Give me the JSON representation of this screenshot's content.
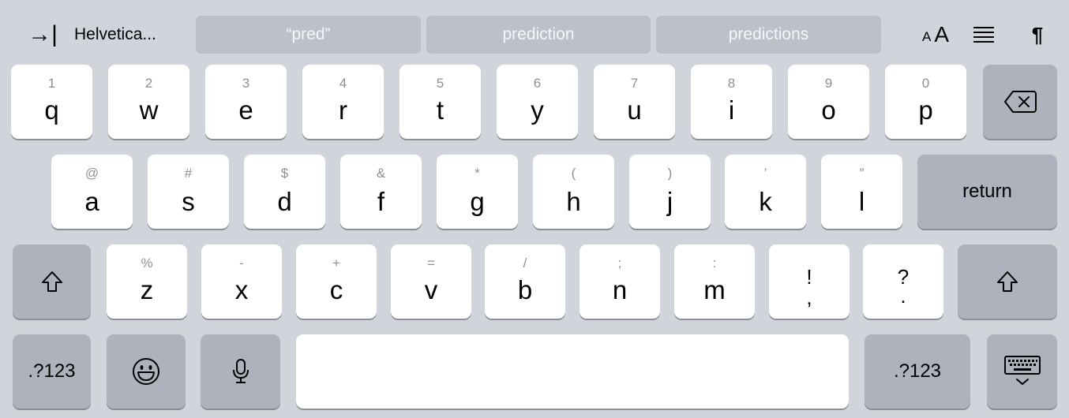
{
  "toolbar": {
    "tab_icon": "→|",
    "font_name": "Helvetica...",
    "suggestions": [
      "“pred”",
      "prediction",
      "predictions"
    ],
    "fontsize_small": "A",
    "fontsize_big": "A",
    "pilcrow": "¶"
  },
  "rows": {
    "row1": [
      {
        "hint": "1",
        "char": "q"
      },
      {
        "hint": "2",
        "char": "w"
      },
      {
        "hint": "3",
        "char": "e"
      },
      {
        "hint": "4",
        "char": "r"
      },
      {
        "hint": "5",
        "char": "t"
      },
      {
        "hint": "6",
        "char": "y"
      },
      {
        "hint": "7",
        "char": "u"
      },
      {
        "hint": "8",
        "char": "i"
      },
      {
        "hint": "9",
        "char": "o"
      },
      {
        "hint": "0",
        "char": "p"
      }
    ],
    "row2": [
      {
        "hint": "@",
        "char": "a"
      },
      {
        "hint": "#",
        "char": "s"
      },
      {
        "hint": "$",
        "char": "d"
      },
      {
        "hint": "&",
        "char": "f"
      },
      {
        "hint": "*",
        "char": "g"
      },
      {
        "hint": "(",
        "char": "h"
      },
      {
        "hint": ")",
        "char": "j"
      },
      {
        "hint": "’",
        "char": "k"
      },
      {
        "hint": "”",
        "char": "l"
      }
    ],
    "row3": [
      {
        "hint": "%",
        "char": "z"
      },
      {
        "hint": "-",
        "char": "x"
      },
      {
        "hint": "+",
        "char": "c"
      },
      {
        "hint": "=",
        "char": "v"
      },
      {
        "hint": "/",
        "char": "b"
      },
      {
        "hint": ";",
        "char": "n"
      },
      {
        "hint": ":",
        "char": "m"
      }
    ],
    "punct": [
      {
        "top": "!",
        "bottom": ","
      },
      {
        "top": "?",
        "bottom": "."
      }
    ]
  },
  "special": {
    "return_label": "return",
    "numbers_label_left": ".?123",
    "numbers_label_right": ".?123"
  },
  "icons": {
    "delete": "delete-icon",
    "shift": "shift-icon",
    "emoji": "emoji-icon",
    "mic": "microphone-icon",
    "dismiss": "keyboard-dismiss-icon",
    "align": "text-align-icon"
  }
}
